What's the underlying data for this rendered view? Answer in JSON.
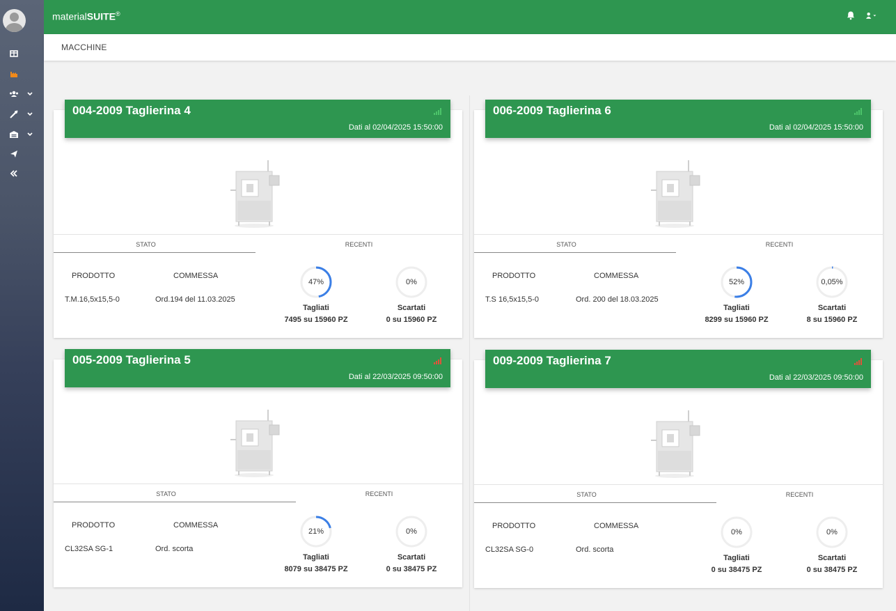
{
  "brand": {
    "prefix": "material",
    "bold": "SUITE",
    "sup": "®"
  },
  "breadcrumb": "MACCHINE",
  "tabs": {
    "stato": "STATO",
    "recenti": "RECENTI"
  },
  "labels": {
    "prodotto": "PRODOTTO",
    "commessa": "COMMESSA",
    "tagliati": "Tagliati",
    "scartati": "Scartati"
  },
  "colors": {
    "green": "#2e9650",
    "gauge_blue": "#3b7fe6",
    "signal_ok": "#4cc46a",
    "signal_bad": "#e0533b"
  },
  "cards": [
    {
      "title": "004-2009 Taglierina 4",
      "date": "Dati al 02/04/2025 15:50:00",
      "signal": "green",
      "prodotto": "T.M.16,5x15,5-0",
      "commessa": "Ord.194 del 11.03.2025",
      "tagliati_pct": "47%",
      "tagliati_frac": 0.47,
      "tagliati_sub": "7495 su 15960 PZ",
      "scartati_pct": "0%",
      "scartati_frac": 0,
      "scartati_sub": "0 su 15960 PZ"
    },
    {
      "title": "006-2009 Taglierina 6",
      "date": "Dati al 02/04/2025 15:50:00",
      "signal": "green",
      "prodotto": "T.S 16,5x15,5-0",
      "commessa": "Ord. 200 del 18.03.2025",
      "tagliati_pct": "52%",
      "tagliati_frac": 0.52,
      "tagliati_sub": "8299 su 15960 PZ",
      "scartati_pct": "0,05%",
      "scartati_frac": 0.01,
      "scartati_sub": "8 su 15960 PZ"
    },
    {
      "title": "005-2009 Taglierina 5",
      "date": "Dati al 22/03/2025 09:50:00",
      "signal": "red",
      "prodotto": "CL32SA SG-1",
      "commessa": "Ord. scorta",
      "tagliati_pct": "21%",
      "tagliati_frac": 0.21,
      "tagliati_sub": "8079 su 38475 PZ",
      "scartati_pct": "0%",
      "scartati_frac": 0,
      "scartati_sub": "0 su 38475 PZ"
    },
    {
      "title": "009-2009 Taglierina 7",
      "date": "Dati al 22/03/2025 09:50:00",
      "signal": "red",
      "prodotto": "CL32SA SG-0",
      "commessa": "Ord. scorta",
      "tagliati_pct": "0%",
      "tagliati_frac": 0,
      "tagliati_sub": "0 su 38475 PZ",
      "scartati_pct": "0%",
      "scartati_frac": 0,
      "scartati_sub": "0 su 38475 PZ"
    }
  ],
  "sidebar": {
    "items": [
      "dashboard-icon",
      "factory-icon",
      "users-icon",
      "tools-icon",
      "warehouse-icon",
      "send-icon",
      "collapse-icon"
    ]
  }
}
